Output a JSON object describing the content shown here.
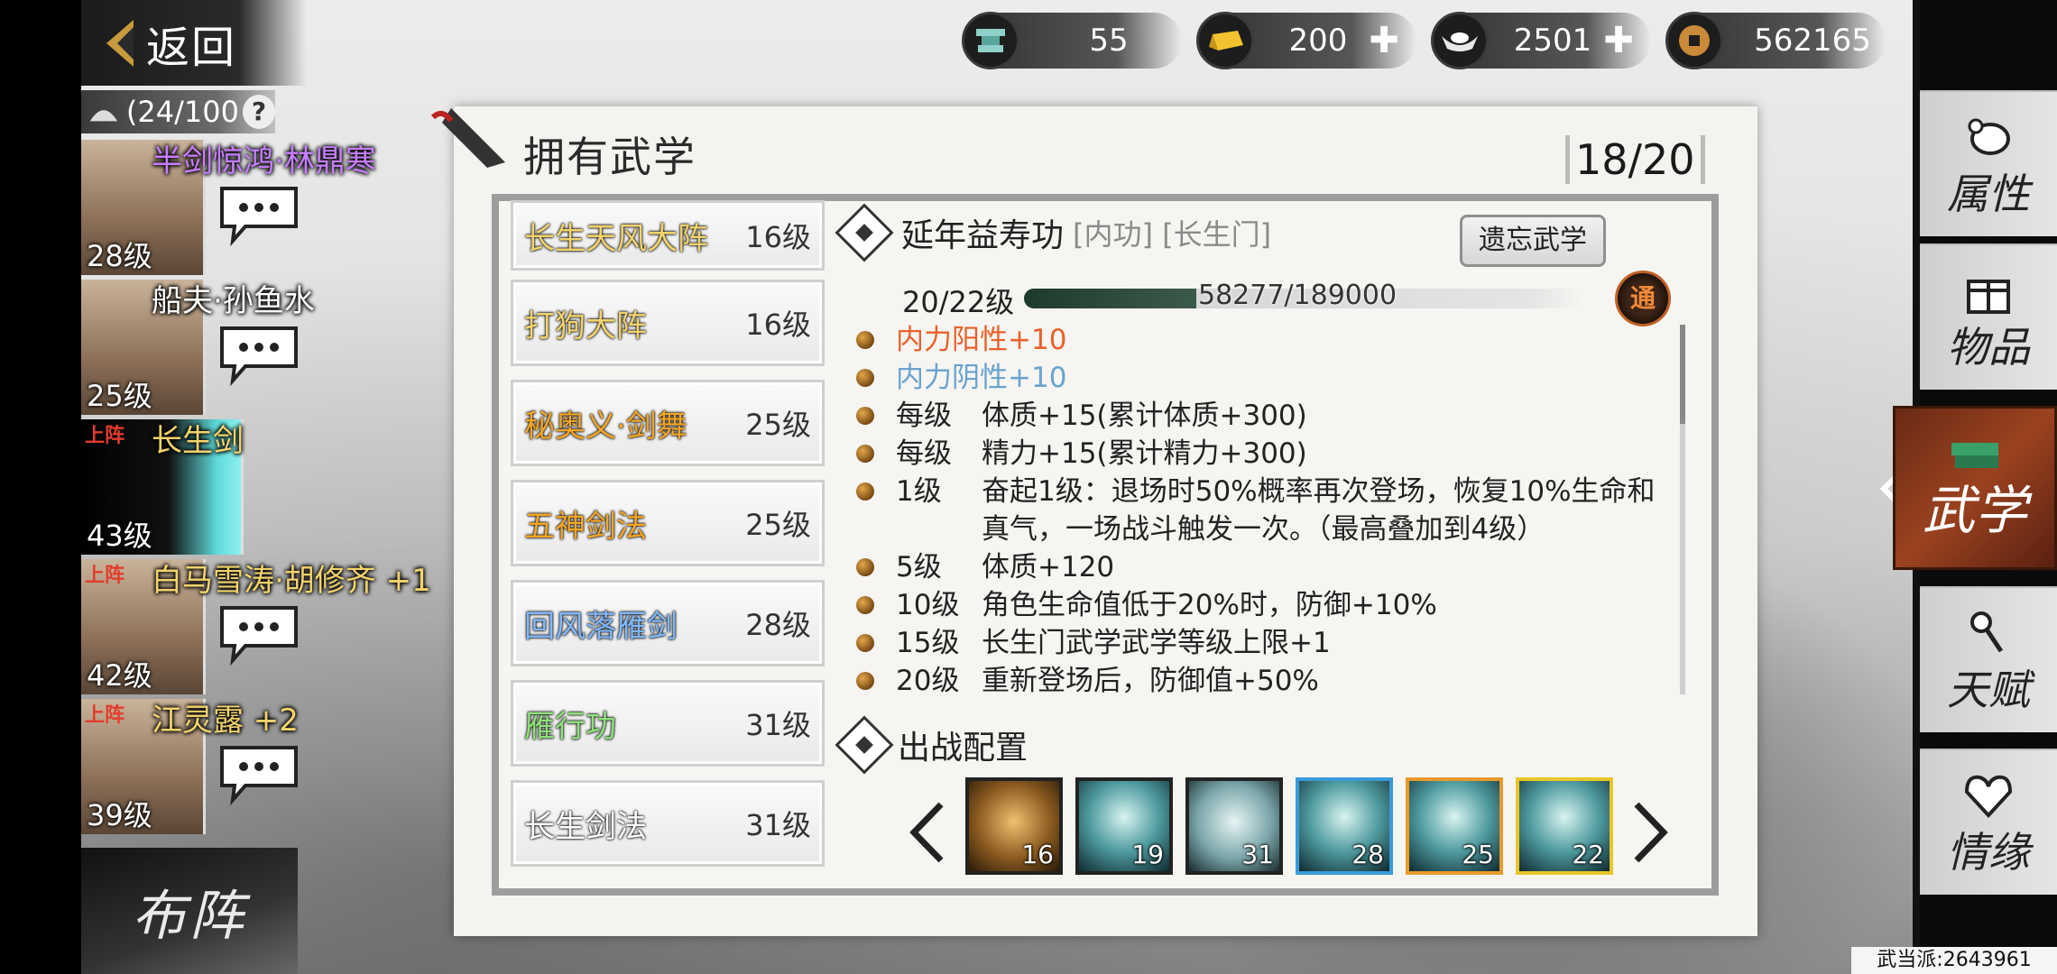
{
  "back": {
    "label": "返回"
  },
  "resources": [
    {
      "icon": "anvil-icon",
      "value": "55",
      "has_plus": false
    },
    {
      "icon": "gold-bar-icon",
      "value": "200",
      "has_plus": true
    },
    {
      "icon": "silver-ingot-icon",
      "value": "2501",
      "has_plus": true
    },
    {
      "icon": "copper-coin-icon",
      "value": "562165",
      "has_plus": false
    }
  ],
  "roster": {
    "count_label": "(24/100",
    "help_label": "?",
    "heroes": [
      {
        "name": "半剑惊鸿·林鼎寒",
        "level": "28级",
        "name_color": "#c77dff",
        "onfield": "",
        "active": false
      },
      {
        "name": "船夫·孙鱼水",
        "level": "25级",
        "name_color": "#ffffff",
        "onfield": "",
        "active": false
      },
      {
        "name": "长生剑",
        "level": "43级",
        "name_color": "#f2d36b",
        "onfield": "上阵",
        "active": true
      },
      {
        "name": "白马雪涛·胡修齐 +1",
        "level": "42级",
        "name_color": "#f2d36b",
        "onfield": "上阵",
        "active": false
      },
      {
        "name": "江灵露 +2",
        "level": "39级",
        "name_color": "#f2d36b",
        "onfield": "上阵",
        "active": false
      }
    ]
  },
  "formation_label": "布阵",
  "panel": {
    "title": "拥有武学",
    "count": "18/20"
  },
  "skills": [
    {
      "name": "长生天风大阵",
      "level": "16级",
      "color": "#f2d36b"
    },
    {
      "name": "打狗大阵",
      "level": "16级",
      "color": "#f2d36b"
    },
    {
      "name": "秘奥义·剑舞",
      "level": "25级",
      "color": "#f5a623"
    },
    {
      "name": "五神剑法",
      "level": "25级",
      "color": "#f5a623"
    },
    {
      "name": "回风落雁剑",
      "level": "28级",
      "color": "#7fb8ff"
    },
    {
      "name": "雁行功",
      "level": "31级",
      "color": "#8ee07a"
    },
    {
      "name": "长生剑法",
      "level": "31级",
      "color": "#ffffff"
    }
  ],
  "detail": {
    "name": "延年益寿功",
    "tags": "[内功] [长生门]",
    "forget_label": "遗忘武学",
    "badge": "通",
    "level_text": "20/22级",
    "exp_text": "58277/189000",
    "exp_current": 58277,
    "exp_max": 189000,
    "effects": [
      {
        "level": "",
        "text": "内力阳性+10",
        "color": "#e8622a"
      },
      {
        "level": "",
        "text": "内力阴性+10",
        "color": "#6aa3cf"
      },
      {
        "level": "每级",
        "text": "体质+15(累计体质+300)",
        "color": "#222222"
      },
      {
        "level": "每级",
        "text": "精力+15(累计精力+300)",
        "color": "#222222"
      },
      {
        "level": "1级",
        "text": "奋起1级：退场时50%概率再次登场，恢复10%生命和真气，一场战斗触发一次。（最高叠加到4级）",
        "color": "#222222"
      },
      {
        "level": "5级",
        "text": "体质+120",
        "color": "#222222"
      },
      {
        "level": "10级",
        "text": "角色生命值低于20%时，防御+10%",
        "color": "#222222"
      },
      {
        "level": "15级",
        "text": "长生门武学武学等级上限+1",
        "color": "#222222"
      },
      {
        "level": "20级",
        "text": "重新登场后，防御值+50%",
        "color": "#222222"
      }
    ]
  },
  "deploy": {
    "title": "出战配置",
    "slots": [
      {
        "value": "16",
        "border": "#222222"
      },
      {
        "value": "19",
        "border": "#222222"
      },
      {
        "value": "31",
        "border": "#222222"
      },
      {
        "value": "28",
        "border": "#3a9ad9"
      },
      {
        "value": "25",
        "border": "#e89a2a"
      },
      {
        "value": "22",
        "border": "#e8c62a"
      }
    ]
  },
  "menu": [
    {
      "label": "属性",
      "icon": "rat-icon",
      "active": false
    },
    {
      "label": "物品",
      "icon": "gift-box-icon",
      "active": false
    },
    {
      "label": "武学",
      "icon": "book-stack-icon",
      "active": true
    },
    {
      "label": "天赋",
      "icon": "talent-key-icon",
      "active": false
    },
    {
      "label": "情缘",
      "icon": "heart-knot-icon",
      "active": false
    }
  ],
  "server_tag": "武当派:2643961"
}
